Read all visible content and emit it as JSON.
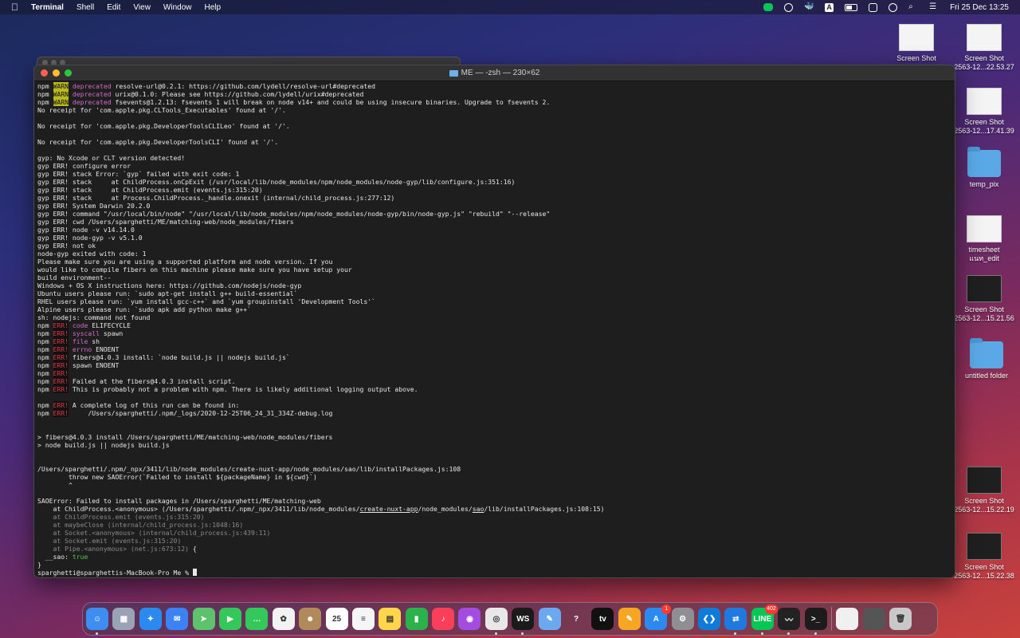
{
  "menubar": {
    "apple": "",
    "app": "Terminal",
    "menus": [
      "Shell",
      "Edit",
      "View",
      "Window",
      "Help"
    ],
    "clock": "Fri 25 Dec  13:25",
    "status_icons": [
      "line-icon",
      "circle-icon",
      "docker-icon",
      "input-source-icon",
      "battery-icon",
      "airplay-icon",
      "user-icon",
      "search-icon",
      "control-center-icon"
    ],
    "input_source_label": "A"
  },
  "terminal": {
    "title": "ME — -zsh — 230×62",
    "lines": [
      [
        {
          "t": "npm "
        },
        {
          "t": "WARN",
          "c": "tag-warn"
        },
        {
          "t": " "
        },
        {
          "t": "deprecated",
          "c": "c-warn"
        },
        {
          "t": " resolve-url@0.2.1: https://github.com/lydell/resolve-url#deprecated"
        }
      ],
      [
        {
          "t": "npm "
        },
        {
          "t": "WARN",
          "c": "tag-warn"
        },
        {
          "t": " "
        },
        {
          "t": "deprecated",
          "c": "c-warn"
        },
        {
          "t": " urix@0.1.0: Please see https://github.com/lydell/urix#deprecated"
        }
      ],
      [
        {
          "t": "npm "
        },
        {
          "t": "WARN",
          "c": "tag-warn"
        },
        {
          "t": " "
        },
        {
          "t": "deprecated",
          "c": "c-warn"
        },
        {
          "t": " fsevents@1.2.13: fsevents 1 will break on node v14+ and could be using insecure binaries. Upgrade to fsevents 2."
        }
      ],
      [
        {
          "t": "No receipt for 'com.apple.pkg.CLTools_Executables' found at '/'."
        }
      ],
      [
        {
          "t": ""
        }
      ],
      [
        {
          "t": "No receipt for 'com.apple.pkg.DeveloperToolsCLILeo' found at '/'."
        }
      ],
      [
        {
          "t": ""
        }
      ],
      [
        {
          "t": "No receipt for 'com.apple.pkg.DeveloperToolsCLI' found at '/'."
        }
      ],
      [
        {
          "t": ""
        }
      ],
      [
        {
          "t": "gyp: No Xcode or CLT version detected!"
        }
      ],
      [
        {
          "t": "gyp ERR! configure error"
        }
      ],
      [
        {
          "t": "gyp ERR! stack Error: `gyp` failed with exit code: 1"
        }
      ],
      [
        {
          "t": "gyp ERR! stack     at ChildProcess.onCpExit (/usr/local/lib/node_modules/npm/node_modules/node-gyp/lib/configure.js:351:16)"
        }
      ],
      [
        {
          "t": "gyp ERR! stack     at ChildProcess.emit (events.js:315:20)"
        }
      ],
      [
        {
          "t": "gyp ERR! stack     at Process.ChildProcess._handle.onexit (internal/child_process.js:277:12)"
        }
      ],
      [
        {
          "t": "gyp ERR! System Darwin 20.2.0"
        }
      ],
      [
        {
          "t": "gyp ERR! command \"/usr/local/bin/node\" \"/usr/local/lib/node_modules/npm/node_modules/node-gyp/bin/node-gyp.js\" \"rebuild\" \"--release\""
        }
      ],
      [
        {
          "t": "gyp ERR! cwd /Users/sparghetti/ME/matching-web/node_modules/fibers"
        }
      ],
      [
        {
          "t": "gyp ERR! node -v v14.14.0"
        }
      ],
      [
        {
          "t": "gyp ERR! node-gyp -v v5.1.0"
        }
      ],
      [
        {
          "t": "gyp ERR! not ok"
        }
      ],
      [
        {
          "t": "node-gyp exited with code: 1"
        }
      ],
      [
        {
          "t": "Please make sure you are using a supported platform and node version. If you"
        }
      ],
      [
        {
          "t": "would like to compile fibers on this machine please make sure you have setup your"
        }
      ],
      [
        {
          "t": "build environment--"
        }
      ],
      [
        {
          "t": "Windows + OS X instructions here: https://github.com/nodejs/node-gyp"
        }
      ],
      [
        {
          "t": "Ubuntu users please run: `sudo apt-get install g++ build-essential`"
        }
      ],
      [
        {
          "t": "RHEL users please run: `yum install gcc-c++` and `yum groupinstall 'Development Tools'`"
        }
      ],
      [
        {
          "t": "Alpine users please run: `sudo apk add python make g++`"
        }
      ],
      [
        {
          "t": "sh: nodejs: command not found"
        }
      ],
      [
        {
          "t": "npm "
        },
        {
          "t": "ERR!",
          "c": "tag-err"
        },
        {
          "t": " "
        },
        {
          "t": "code",
          "c": "c-err"
        },
        {
          "t": " ELIFECYCLE"
        }
      ],
      [
        {
          "t": "npm "
        },
        {
          "t": "ERR!",
          "c": "tag-err"
        },
        {
          "t": " "
        },
        {
          "t": "syscall",
          "c": "c-err"
        },
        {
          "t": " spawn"
        }
      ],
      [
        {
          "t": "npm "
        },
        {
          "t": "ERR!",
          "c": "tag-err"
        },
        {
          "t": " "
        },
        {
          "t": "file",
          "c": "c-err"
        },
        {
          "t": " sh"
        }
      ],
      [
        {
          "t": "npm "
        },
        {
          "t": "ERR!",
          "c": "tag-err"
        },
        {
          "t": " "
        },
        {
          "t": "errno",
          "c": "c-err"
        },
        {
          "t": " ENOENT"
        }
      ],
      [
        {
          "t": "npm "
        },
        {
          "t": "ERR!",
          "c": "tag-err"
        },
        {
          "t": " fibers@4.0.3 install: `node build.js || nodejs build.js`"
        }
      ],
      [
        {
          "t": "npm "
        },
        {
          "t": "ERR!",
          "c": "tag-err"
        },
        {
          "t": " spawn ENOENT"
        }
      ],
      [
        {
          "t": "npm "
        },
        {
          "t": "ERR!",
          "c": "tag-err"
        }
      ],
      [
        {
          "t": "npm "
        },
        {
          "t": "ERR!",
          "c": "tag-err"
        },
        {
          "t": " Failed at the fibers@4.0.3 install script."
        }
      ],
      [
        {
          "t": "npm "
        },
        {
          "t": "ERR!",
          "c": "tag-err"
        },
        {
          "t": " This is probably not a problem with npm. There is likely additional logging output above."
        }
      ],
      [
        {
          "t": ""
        }
      ],
      [
        {
          "t": "npm "
        },
        {
          "t": "ERR!",
          "c": "tag-err"
        },
        {
          "t": " A complete log of this run can be found in:"
        }
      ],
      [
        {
          "t": "npm "
        },
        {
          "t": "ERR!",
          "c": "tag-err"
        },
        {
          "t": "     /Users/sparghetti/.npm/_logs/2020-12-25T06_24_31_334Z-debug.log"
        }
      ],
      [
        {
          "t": ""
        }
      ],
      [
        {
          "t": ""
        }
      ],
      [
        {
          "t": "> fibers@4.0.3 install /Users/sparghetti/ME/matching-web/node_modules/fibers"
        }
      ],
      [
        {
          "t": "> node build.js || nodejs build.js"
        }
      ],
      [
        {
          "t": ""
        }
      ],
      [
        {
          "t": ""
        }
      ],
      [
        {
          "t": "/Users/sparghetti/.npm/_npx/3411/lib/node_modules/create-nuxt-app/node_modules/sao/lib/installPackages.js:108"
        }
      ],
      [
        {
          "t": "        throw new SAOError(`Failed to install ${packageName} in ${cwd}`)"
        }
      ],
      [
        {
          "t": "        ^"
        }
      ],
      [
        {
          "t": ""
        }
      ],
      [
        {
          "t": "SAOError: Failed to install packages in /Users/sparghetti/ME/matching-web"
        }
      ],
      [
        {
          "t": "    at ChildProcess.<anonymous> (/Users/sparghetti/.npm/_npx/3411/lib/node_modules/"
        },
        {
          "t": "create-nuxt-app",
          "c": "u"
        },
        {
          "t": "/node_modules/"
        },
        {
          "t": "sao",
          "c": "u"
        },
        {
          "t": "/lib/installPackages.js:108:15)"
        }
      ],
      [
        {
          "t": "    at ChildProcess.emit (events.js:315:20)",
          "c": "c-dim"
        }
      ],
      [
        {
          "t": "    at maybeClose (internal/child_process.js:1048:16)",
          "c": "c-dim"
        }
      ],
      [
        {
          "t": "    at Socket.<anonymous> (internal/child_process.js:439:11)",
          "c": "c-dim"
        }
      ],
      [
        {
          "t": "    at Socket.emit (events.js:315:20)",
          "c": "c-dim"
        }
      ],
      [
        {
          "t": "    at Pipe.<anonymous> (net.js:673:12)",
          "c": "c-dim"
        },
        {
          "t": " {"
        }
      ],
      [
        {
          "t": "  __sao: "
        },
        {
          "t": "true",
          "c": "c-green"
        }
      ],
      [
        {
          "t": "}"
        }
      ],
      [
        {
          "t": "sparghetti@sparghettis-MacBook-Pro Me % "
        }
      ]
    ]
  },
  "desktop_icons": [
    {
      "label": "Screen Shot",
      "kind": "thumb"
    },
    {
      "label": "Screen Shot\n2563-12...22.53.27",
      "kind": "thumb"
    },
    {
      "label": "Screen Shot\n2563-12...17.41.39",
      "kind": "thumb"
    },
    {
      "label": "temp_pix",
      "kind": "folder"
    },
    {
      "label": "timesheet\nแนท_edit",
      "kind": "thumb"
    },
    {
      "label": "Screen Shot\n2563-12...15.21.56",
      "kind": "dark"
    },
    {
      "label": "untitled folder",
      "kind": "folder"
    },
    {
      "label": "Screen Shot\n2563-12...15.22.19",
      "kind": "dark"
    },
    {
      "label": "Screen Shot\n2563-12...15.22.38",
      "kind": "dark"
    }
  ],
  "dock": {
    "apps": [
      {
        "name": "finder-icon",
        "color": "#3d8ef0",
        "glyph": "☺",
        "running": true
      },
      {
        "name": "launchpad-icon",
        "color": "#9aa3b5",
        "glyph": "▦"
      },
      {
        "name": "safari-icon",
        "color": "#2a8af0",
        "glyph": "✦"
      },
      {
        "name": "mail-icon",
        "color": "#3b82f6",
        "glyph": "✉"
      },
      {
        "name": "maps-icon",
        "color": "#5cc26b",
        "glyph": "➤"
      },
      {
        "name": "facetime-icon",
        "color": "#34c759",
        "glyph": "▶"
      },
      {
        "name": "messages-icon",
        "color": "#34c759",
        "glyph": "…"
      },
      {
        "name": "photos-icon",
        "color": "#f2f2f2",
        "glyph": "✿"
      },
      {
        "name": "contacts-icon",
        "color": "#b08a5a",
        "glyph": "☻"
      },
      {
        "name": "calendar-icon",
        "color": "#ffffff",
        "glyph": "25"
      },
      {
        "name": "reminders-icon",
        "color": "#f5f5f5",
        "glyph": "≡"
      },
      {
        "name": "notes-icon",
        "color": "#ffd54a",
        "glyph": "▤"
      },
      {
        "name": "numbers-icon",
        "color": "#29b34a",
        "glyph": "▮"
      },
      {
        "name": "music-icon",
        "color": "#fa3f5b",
        "glyph": "♪"
      },
      {
        "name": "podcasts-icon",
        "color": "#a24de0",
        "glyph": "◉"
      },
      {
        "name": "chrome-icon",
        "color": "#e8e8e8",
        "glyph": "◎",
        "running": true
      },
      {
        "name": "webstorm-icon",
        "color": "#1b1b1b",
        "glyph": "WS",
        "running": true
      },
      {
        "name": "preview-icon",
        "color": "#6aa9f0",
        "glyph": "✎"
      },
      {
        "name": "help-icon",
        "color": "transparent",
        "glyph": "?"
      },
      {
        "name": "apple-tv-icon",
        "color": "#111111",
        "glyph": "tv"
      },
      {
        "name": "pages-icon",
        "color": "#f6a623",
        "glyph": "✎"
      },
      {
        "name": "app-store-icon",
        "color": "#2a8af0",
        "glyph": "A",
        "badge": "1"
      },
      {
        "name": "system-preferences-icon",
        "color": "#8e8e93",
        "glyph": "⚙"
      },
      {
        "name": "vscode-icon",
        "color": "#0f7ad8",
        "glyph": "❮❯"
      },
      {
        "name": "teamviewer-icon",
        "color": "#1f7ae0",
        "glyph": "⇄",
        "running": true
      },
      {
        "name": "line-icon",
        "color": "#06c755",
        "glyph": "LINE",
        "badge": "402",
        "running": true
      },
      {
        "name": "activity-monitor-icon",
        "color": "#222222",
        "glyph": "〰",
        "running": true
      },
      {
        "name": "terminal-icon",
        "color": "#1c1c1c",
        "glyph": ">_",
        "running": true
      }
    ],
    "right": [
      {
        "name": "downloads-stack-icon",
        "color": "#f0f0f0",
        "glyph": ""
      },
      {
        "name": "screenshot-stack-icon",
        "color": "#555555",
        "glyph": ""
      },
      {
        "name": "trash-icon",
        "color": "#c8c8c8",
        "glyph": "🗑"
      }
    ]
  }
}
